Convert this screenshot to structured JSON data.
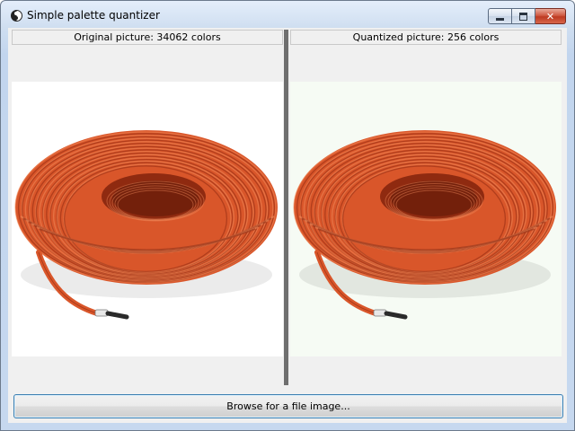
{
  "window": {
    "title": "Simple palette quantizer",
    "icon": "yin-yang-icon",
    "controls": {
      "minimize": "minimize-icon",
      "maximize": "maximize-icon",
      "close": "close-icon"
    }
  },
  "panels": {
    "original": {
      "label": "Original picture: 34062 colors",
      "image": "orange coiled rope"
    },
    "quantized": {
      "label": "Quantized picture: 256 colors",
      "image": "orange coiled rope"
    }
  },
  "browse_button": {
    "label": "Browse for a file image..."
  },
  "colors": {
    "rope": "#d9562a",
    "rope_dark": "#8f2a10",
    "rope_light": "#f08a5a",
    "divider": "#6f6f6f",
    "button_border": "#3c7fb1"
  }
}
